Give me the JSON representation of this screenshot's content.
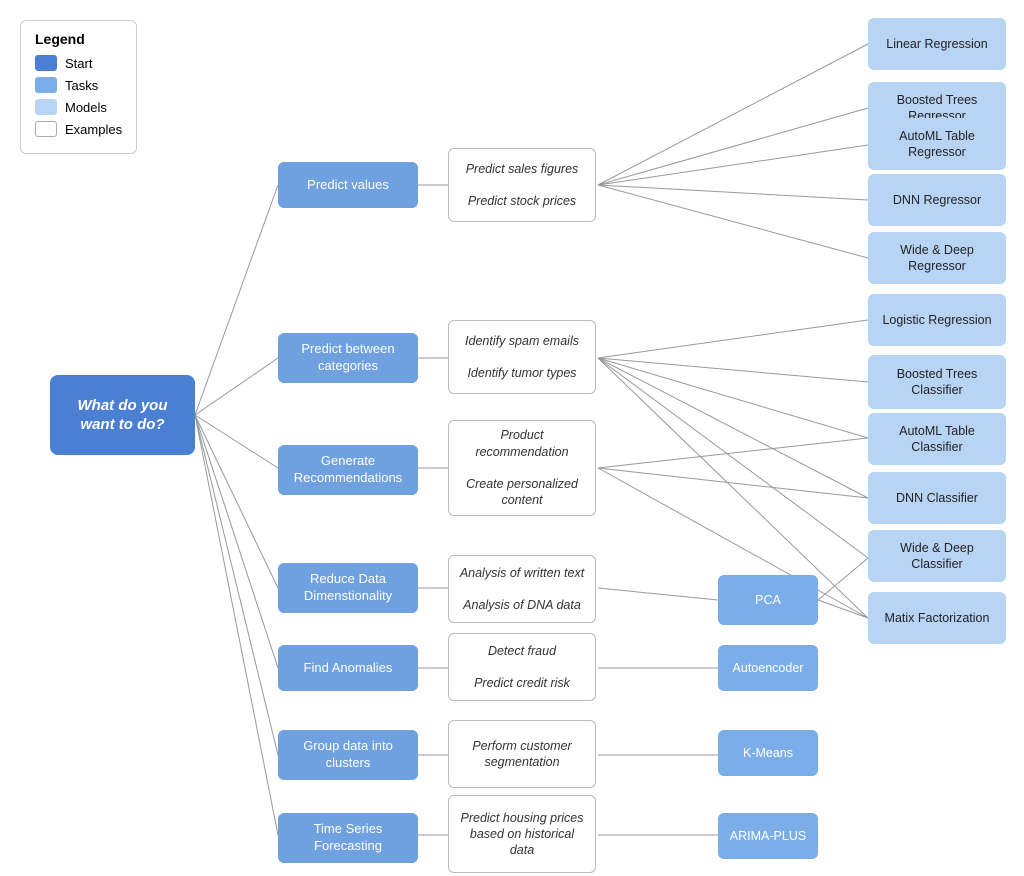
{
  "legend": {
    "title": "Legend",
    "items": [
      {
        "label": "Start",
        "type": "start"
      },
      {
        "label": "Tasks",
        "type": "tasks"
      },
      {
        "label": "Models",
        "type": "models"
      },
      {
        "label": "Examples",
        "type": "examples"
      }
    ]
  },
  "start": {
    "label": "What do you\nwant to do?"
  },
  "tasks": [
    {
      "id": "predict-values",
      "label": "Predict values"
    },
    {
      "id": "predict-between",
      "label": "Predict between\ncategories"
    },
    {
      "id": "generate-rec",
      "label": "Generate\nRecommendations"
    },
    {
      "id": "reduce-dim",
      "label": "Reduce Data\nDimenstionality"
    },
    {
      "id": "find-anomalies",
      "label": "Find Anomalies"
    },
    {
      "id": "group-clusters",
      "label": "Group data into\nclusters"
    },
    {
      "id": "time-series",
      "label": "Time Series\nForecasting"
    }
  ],
  "examples": [
    {
      "id": "ex-predict-values",
      "task": "predict-values",
      "label": "Predict sales figures\n\nPredict stock prices"
    },
    {
      "id": "ex-spam",
      "task": "predict-between",
      "label": "Identify spam emails\n\nIdentify tumor types"
    },
    {
      "id": "ex-rec",
      "task": "generate-rec",
      "label": "Product\nrecommendation\n\nCreate personalized\ncontent"
    },
    {
      "id": "ex-dim",
      "task": "reduce-dim",
      "label": "Analysis of written text\n\nAnalysis of DNA data"
    },
    {
      "id": "ex-anomaly",
      "task": "find-anomalies",
      "label": "Detect fraud\n\nPredict credit risk"
    },
    {
      "id": "ex-cluster",
      "task": "group-clusters",
      "label": "Perform customer\nsegmentation"
    },
    {
      "id": "ex-ts",
      "task": "time-series",
      "label": "Predict housing prices\nbased on historical\ndata"
    }
  ],
  "models": [
    {
      "id": "linear-reg",
      "label": "Linear Regression",
      "group": "regression"
    },
    {
      "id": "boosted-reg",
      "label": "Boosted Trees\nRegressor",
      "group": "regression"
    },
    {
      "id": "automl-reg",
      "label": "AutoML Table\nRegressor",
      "group": "regression"
    },
    {
      "id": "dnn-reg",
      "label": "DNN Regressor",
      "group": "regression"
    },
    {
      "id": "wide-deep-reg",
      "label": "Wide & Deep\nRegressor",
      "group": "regression"
    },
    {
      "id": "logistic-reg",
      "label": "Logistic Regression",
      "group": "classifier"
    },
    {
      "id": "boosted-cls",
      "label": "Boosted Trees\nClassifier",
      "group": "classifier"
    },
    {
      "id": "automl-cls",
      "label": "AutoML Table\nClassifier",
      "group": "classifier"
    },
    {
      "id": "dnn-cls",
      "label": "DNN Classifier",
      "group": "classifier"
    },
    {
      "id": "wide-deep-cls",
      "label": "Wide & Deep\nClassifier",
      "group": "classifier"
    },
    {
      "id": "matrix-fact",
      "label": "Matix Factorization",
      "group": "classifier"
    },
    {
      "id": "pca",
      "label": "PCA",
      "group": "dim"
    },
    {
      "id": "autoencoder",
      "label": "Autoencoder",
      "group": "anomaly"
    },
    {
      "id": "kmeans",
      "label": "K-Means",
      "group": "cluster"
    },
    {
      "id": "arima",
      "label": "ARIMA-PLUS",
      "group": "ts"
    }
  ]
}
